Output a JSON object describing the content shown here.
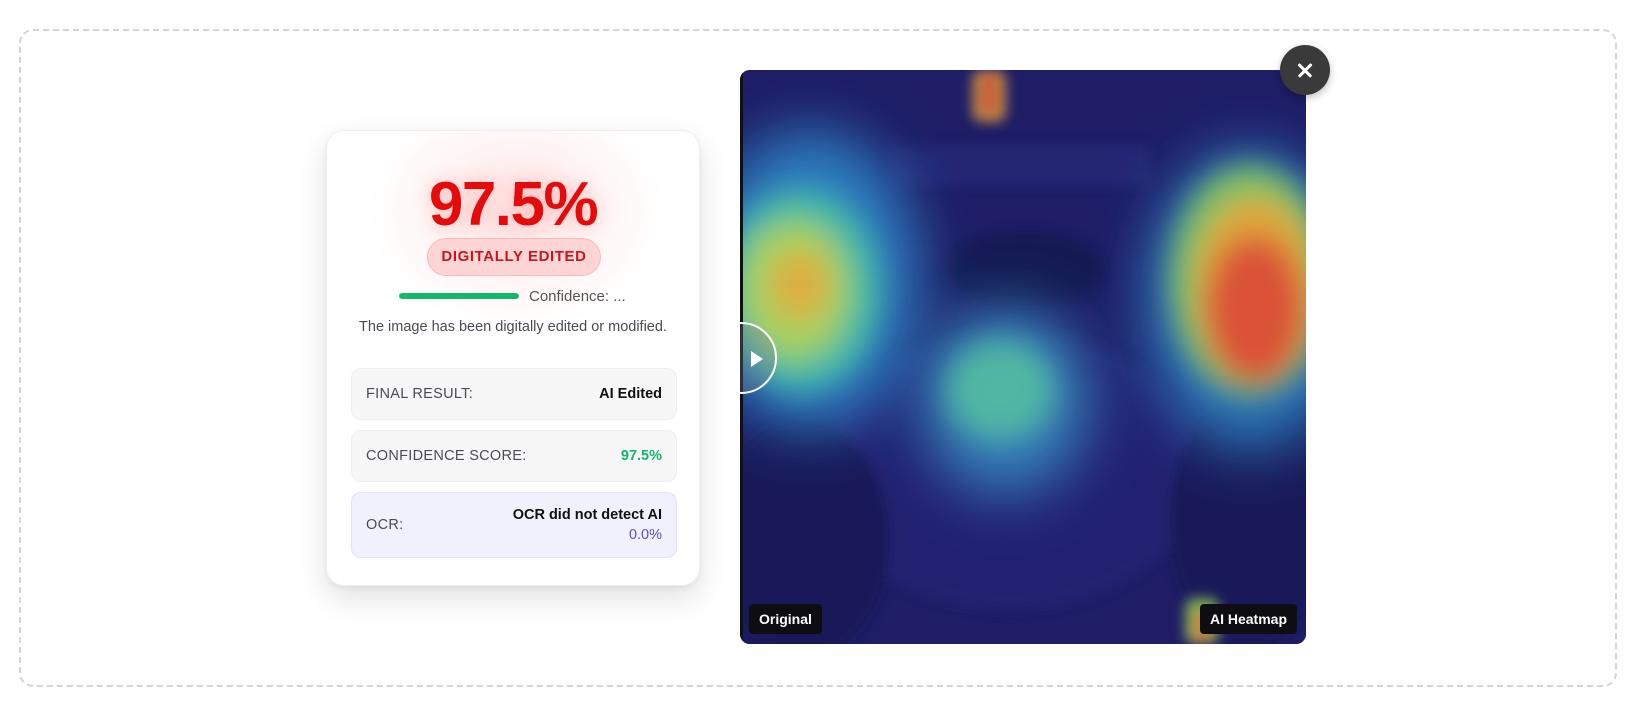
{
  "result": {
    "score_text": "97.5%",
    "verdict_label": "DIGITALLY EDITED",
    "confidence_label": "Confidence: ...",
    "confidence_fill": 1.0,
    "description": "The image has been digitally edited or modified.",
    "final_result": {
      "label": "FINAL RESULT:",
      "value": "AI Edited"
    },
    "confidence_score": {
      "label": "CONFIDENCE SCORE:",
      "value": "97.5%"
    },
    "ocr": {
      "label": "OCR:",
      "value": "OCR did not detect AI",
      "score": "0.0%"
    }
  },
  "image_viewer": {
    "label_original": "Original",
    "label_heatmap": "AI Heatmap",
    "slider_position": 0.0
  },
  "colors": {
    "score_red": "#e60b0b",
    "badge_bg": "#fdd5d5",
    "confidence_green": "#12b76a",
    "ocr_purple": "#5b4fc7",
    "heatmap_base": "#1e1d66"
  },
  "icons": {
    "close": "close-icon",
    "slider": "play-arrow-icon"
  }
}
